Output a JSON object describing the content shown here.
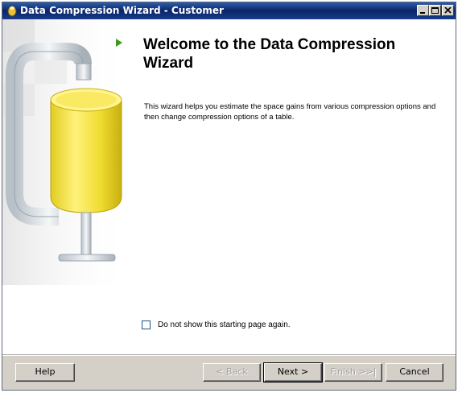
{
  "window": {
    "title": "Data Compression Wizard - Customer"
  },
  "page": {
    "heading": "Welcome to the Data Compression Wizard",
    "description": "This wizard helps you estimate the space gains from various compression options and then change compression options of a table.",
    "checkbox_label": "Do not show this starting page again.",
    "checkbox_checked": false
  },
  "buttons": {
    "help": "Help",
    "back": "< Back",
    "next": "Next >",
    "finish": "Finish >>|",
    "cancel": "Cancel"
  },
  "colors": {
    "titlebar": "#0a246a",
    "arrow": "#3a9a1a",
    "cylinder": "#f2e24a",
    "footer": "#d4d0c8"
  }
}
